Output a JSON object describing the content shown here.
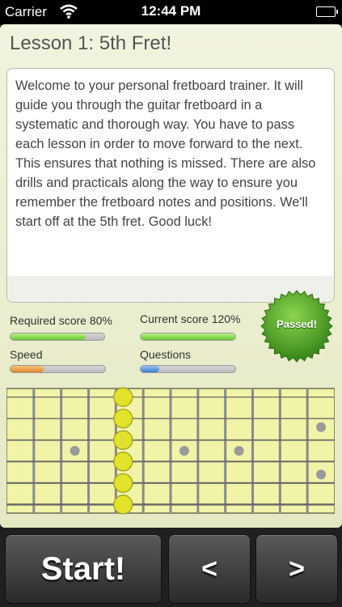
{
  "status_bar": {
    "carrier": "Carrier",
    "time": "12:44 PM"
  },
  "lesson": {
    "title": "Lesson 1: 5th Fret!",
    "intro": "Welcome to your personal fretboard trainer. It will guide you through the guitar fretboard in a systematic and thorough way. You have to pass each lesson in order to move forward to the next. This ensures that nothing is missed. There are also drills and practicals along the way to ensure you remember the fretboard notes and positions. We'll start off at the 5th fret. Good luck!"
  },
  "metrics": {
    "required": {
      "label": "Required score 80%",
      "level": 0.8
    },
    "current": {
      "label": "Current score 120%",
      "level": 1.0
    },
    "speed": {
      "label": "Speed",
      "level": 0.35
    },
    "questions": {
      "label": "Questions",
      "level": 0.2
    }
  },
  "badge": {
    "label": "Passed!"
  },
  "fretboard": {
    "highlighted_fret": 5,
    "strings": 6
  },
  "toolbar": {
    "start_label": "Start!",
    "prev_label": "<",
    "next_label": ">"
  },
  "colors": {
    "panel": "#eef0d6",
    "fretboard": "#f1f3a6",
    "marker": "#e2e22a",
    "badge": "#3f9e1e",
    "toolbar": "#202020"
  }
}
